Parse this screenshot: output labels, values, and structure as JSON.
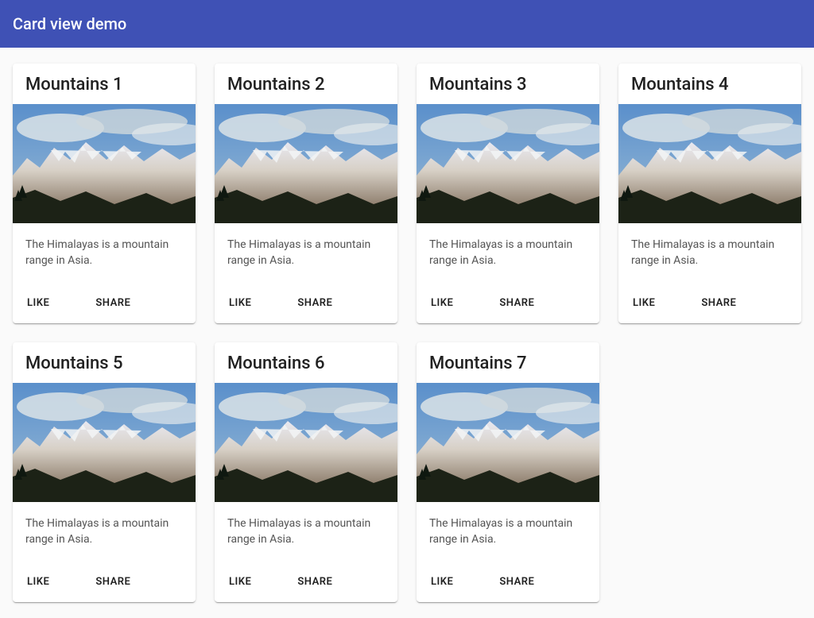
{
  "header": {
    "title": "Card view demo"
  },
  "actions": {
    "like_label": "LIKE",
    "share_label": "SHARE"
  },
  "cards": [
    {
      "title": "Mountains 1",
      "description": "The Himalayas is a mountain range in Asia."
    },
    {
      "title": "Mountains 2",
      "description": "The Himalayas is a mountain range in Asia."
    },
    {
      "title": "Mountains 3",
      "description": "The Himalayas is a mountain range in Asia."
    },
    {
      "title": "Mountains 4",
      "description": "The Himalayas is a mountain range in Asia."
    },
    {
      "title": "Mountains 5",
      "description": "The Himalayas is a mountain range in Asia."
    },
    {
      "title": "Mountains 6",
      "description": "The Himalayas is a mountain range in Asia."
    },
    {
      "title": "Mountains 7",
      "description": "The Himalayas is a mountain range in Asia."
    }
  ]
}
